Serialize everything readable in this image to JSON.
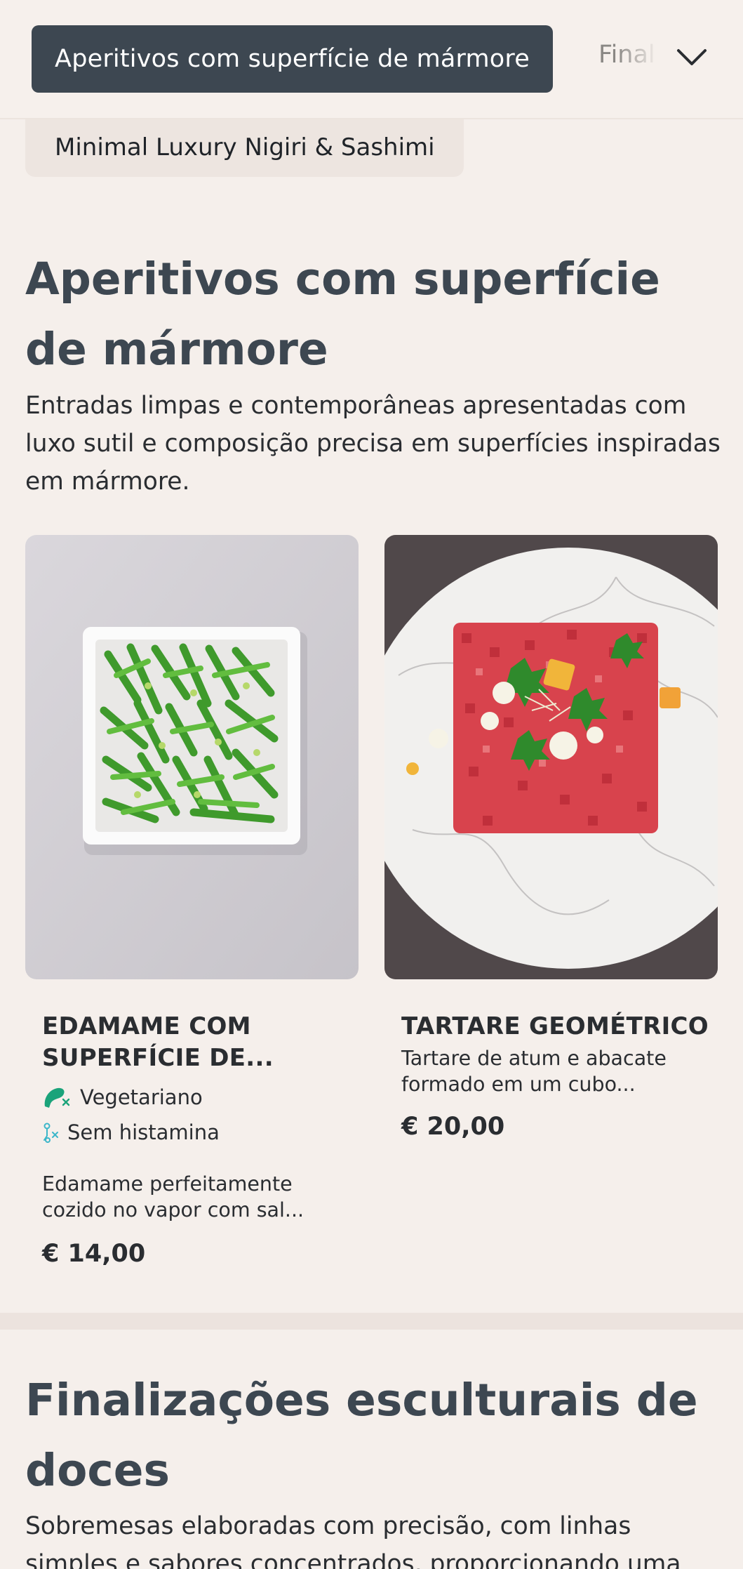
{
  "category_bar": {
    "active": "Aperitivos com superfície de mármore",
    "next": "Finalizações esculturais de doces",
    "previous": "Minimal Luxury Nigiri & Sashimi"
  },
  "section1": {
    "title": "Aperitivos com superfície de mármore",
    "description": "Entradas limpas e contemporâneas apresentadas com luxo sutil e composição precisa em superfícies inspiradas em mármore."
  },
  "items": [
    {
      "name": "EDAMAME COM SUPERFÍCIE DE...",
      "tags": [
        {
          "label": "Vegetariano",
          "icon": "vegetarian-icon"
        },
        {
          "label": "Sem histamina",
          "icon": "histamine-free-icon"
        }
      ],
      "description": "Edamame perfeitamente cozido no vapor com sal...",
      "price": "€ 14,00"
    },
    {
      "name": "TARTARE GEOMÉTRICO",
      "tags": [],
      "description": "Tartare de atum e abacate formado em um cubo...",
      "price": "€ 20,00"
    }
  ],
  "section2": {
    "title": "Finalizações esculturais de doces",
    "description": "Sobremesas elaboradas com precisão, com linhas simples e sabores concentrados, proporcionando uma"
  },
  "colors": {
    "background": "#f5efeb",
    "active_pill": "#3d4751",
    "heading": "#3d4751",
    "vegetarian_icon": "#1aa37a",
    "histamine_icon": "#3bb6c9"
  }
}
